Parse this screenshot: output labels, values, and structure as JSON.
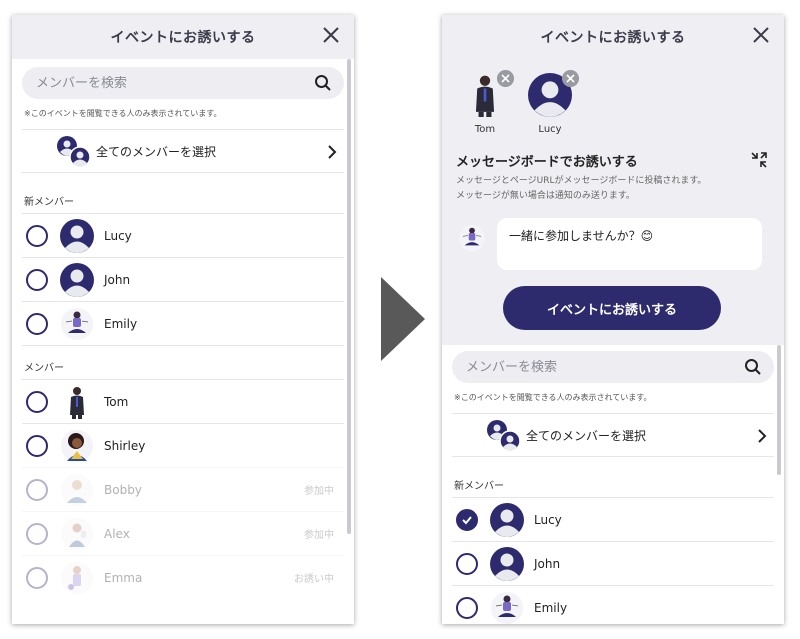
{
  "left": {
    "title": "イベントにお誘いする",
    "search_placeholder": "メンバーを検索",
    "note": "※このイベントを閲覧できる人のみ表示されています。",
    "select_all": "全てのメンバーを選択",
    "new_members_label": "新メンバー",
    "new_members": [
      {
        "name": "Lucy",
        "checked": false
      },
      {
        "name": "John",
        "checked": false
      },
      {
        "name": "Emily",
        "checked": false
      }
    ],
    "members_label": "メンバー",
    "members": [
      {
        "name": "Tom",
        "status": ""
      },
      {
        "name": "Shirley",
        "status": ""
      },
      {
        "name": "Bobby",
        "status": "参加中"
      },
      {
        "name": "Alex",
        "status": "参加中"
      },
      {
        "name": "Emma",
        "status": "お誘い中"
      }
    ]
  },
  "right": {
    "title": "イベントにお誘いする",
    "selected": [
      {
        "name": "Tom"
      },
      {
        "name": "Lucy"
      }
    ],
    "message_board_title": "メッセージボードでお誘いする",
    "message_board_desc_1": "メッセージとページURLがメッセージボードに投稿されます。",
    "message_board_desc_2": "メッセージが無い場合は通知のみ送ります。",
    "message_text": "一緒に参加しませんか？😊",
    "invite_button": "イベントにお誘いする",
    "search_placeholder": "メンバーを検索",
    "note": "※このイベントを閲覧できる人のみ表示されています。",
    "select_all": "全てのメンバーを選択",
    "new_members_label": "新メンバー",
    "new_members": [
      {
        "name": "Lucy",
        "checked": true
      },
      {
        "name": "John",
        "checked": false
      },
      {
        "name": "Emily",
        "checked": false
      }
    ]
  },
  "colors": {
    "accent": "#2e2a6e",
    "header_bg": "#efeff3",
    "arrow": "#595959"
  }
}
